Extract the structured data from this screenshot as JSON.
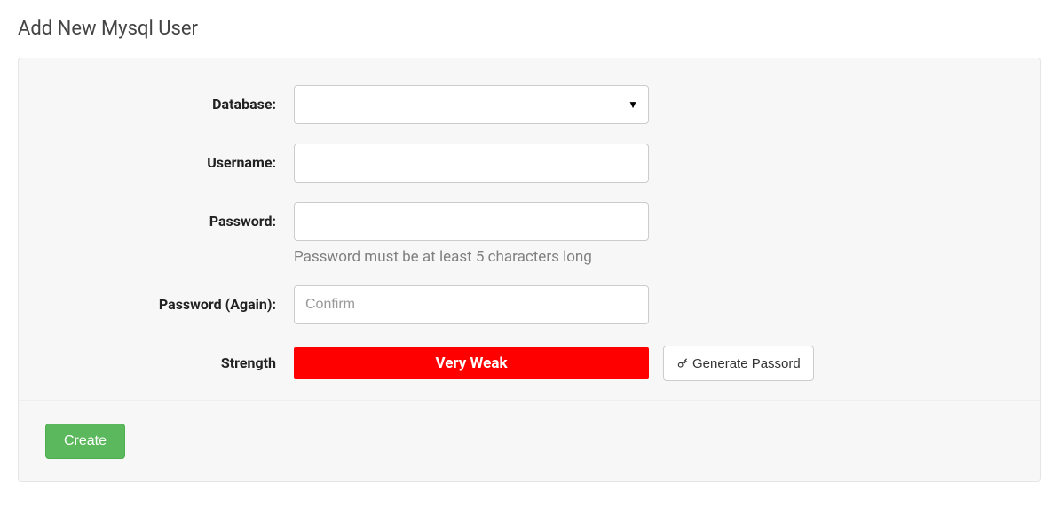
{
  "page": {
    "title": "Add New Mysql User"
  },
  "form": {
    "database": {
      "label": "Database:",
      "value": ""
    },
    "username": {
      "label": "Username:",
      "value": ""
    },
    "password": {
      "label": "Password:",
      "value": "",
      "help": "Password must be at least 5 characters long"
    },
    "password_again": {
      "label": "Password (Again):",
      "placeholder": "Confirm",
      "value": ""
    },
    "strength": {
      "label": "Strength",
      "value": "Very Weak",
      "color": "#ff0000"
    },
    "generate_button": "Generate Passord",
    "create_button": "Create"
  }
}
